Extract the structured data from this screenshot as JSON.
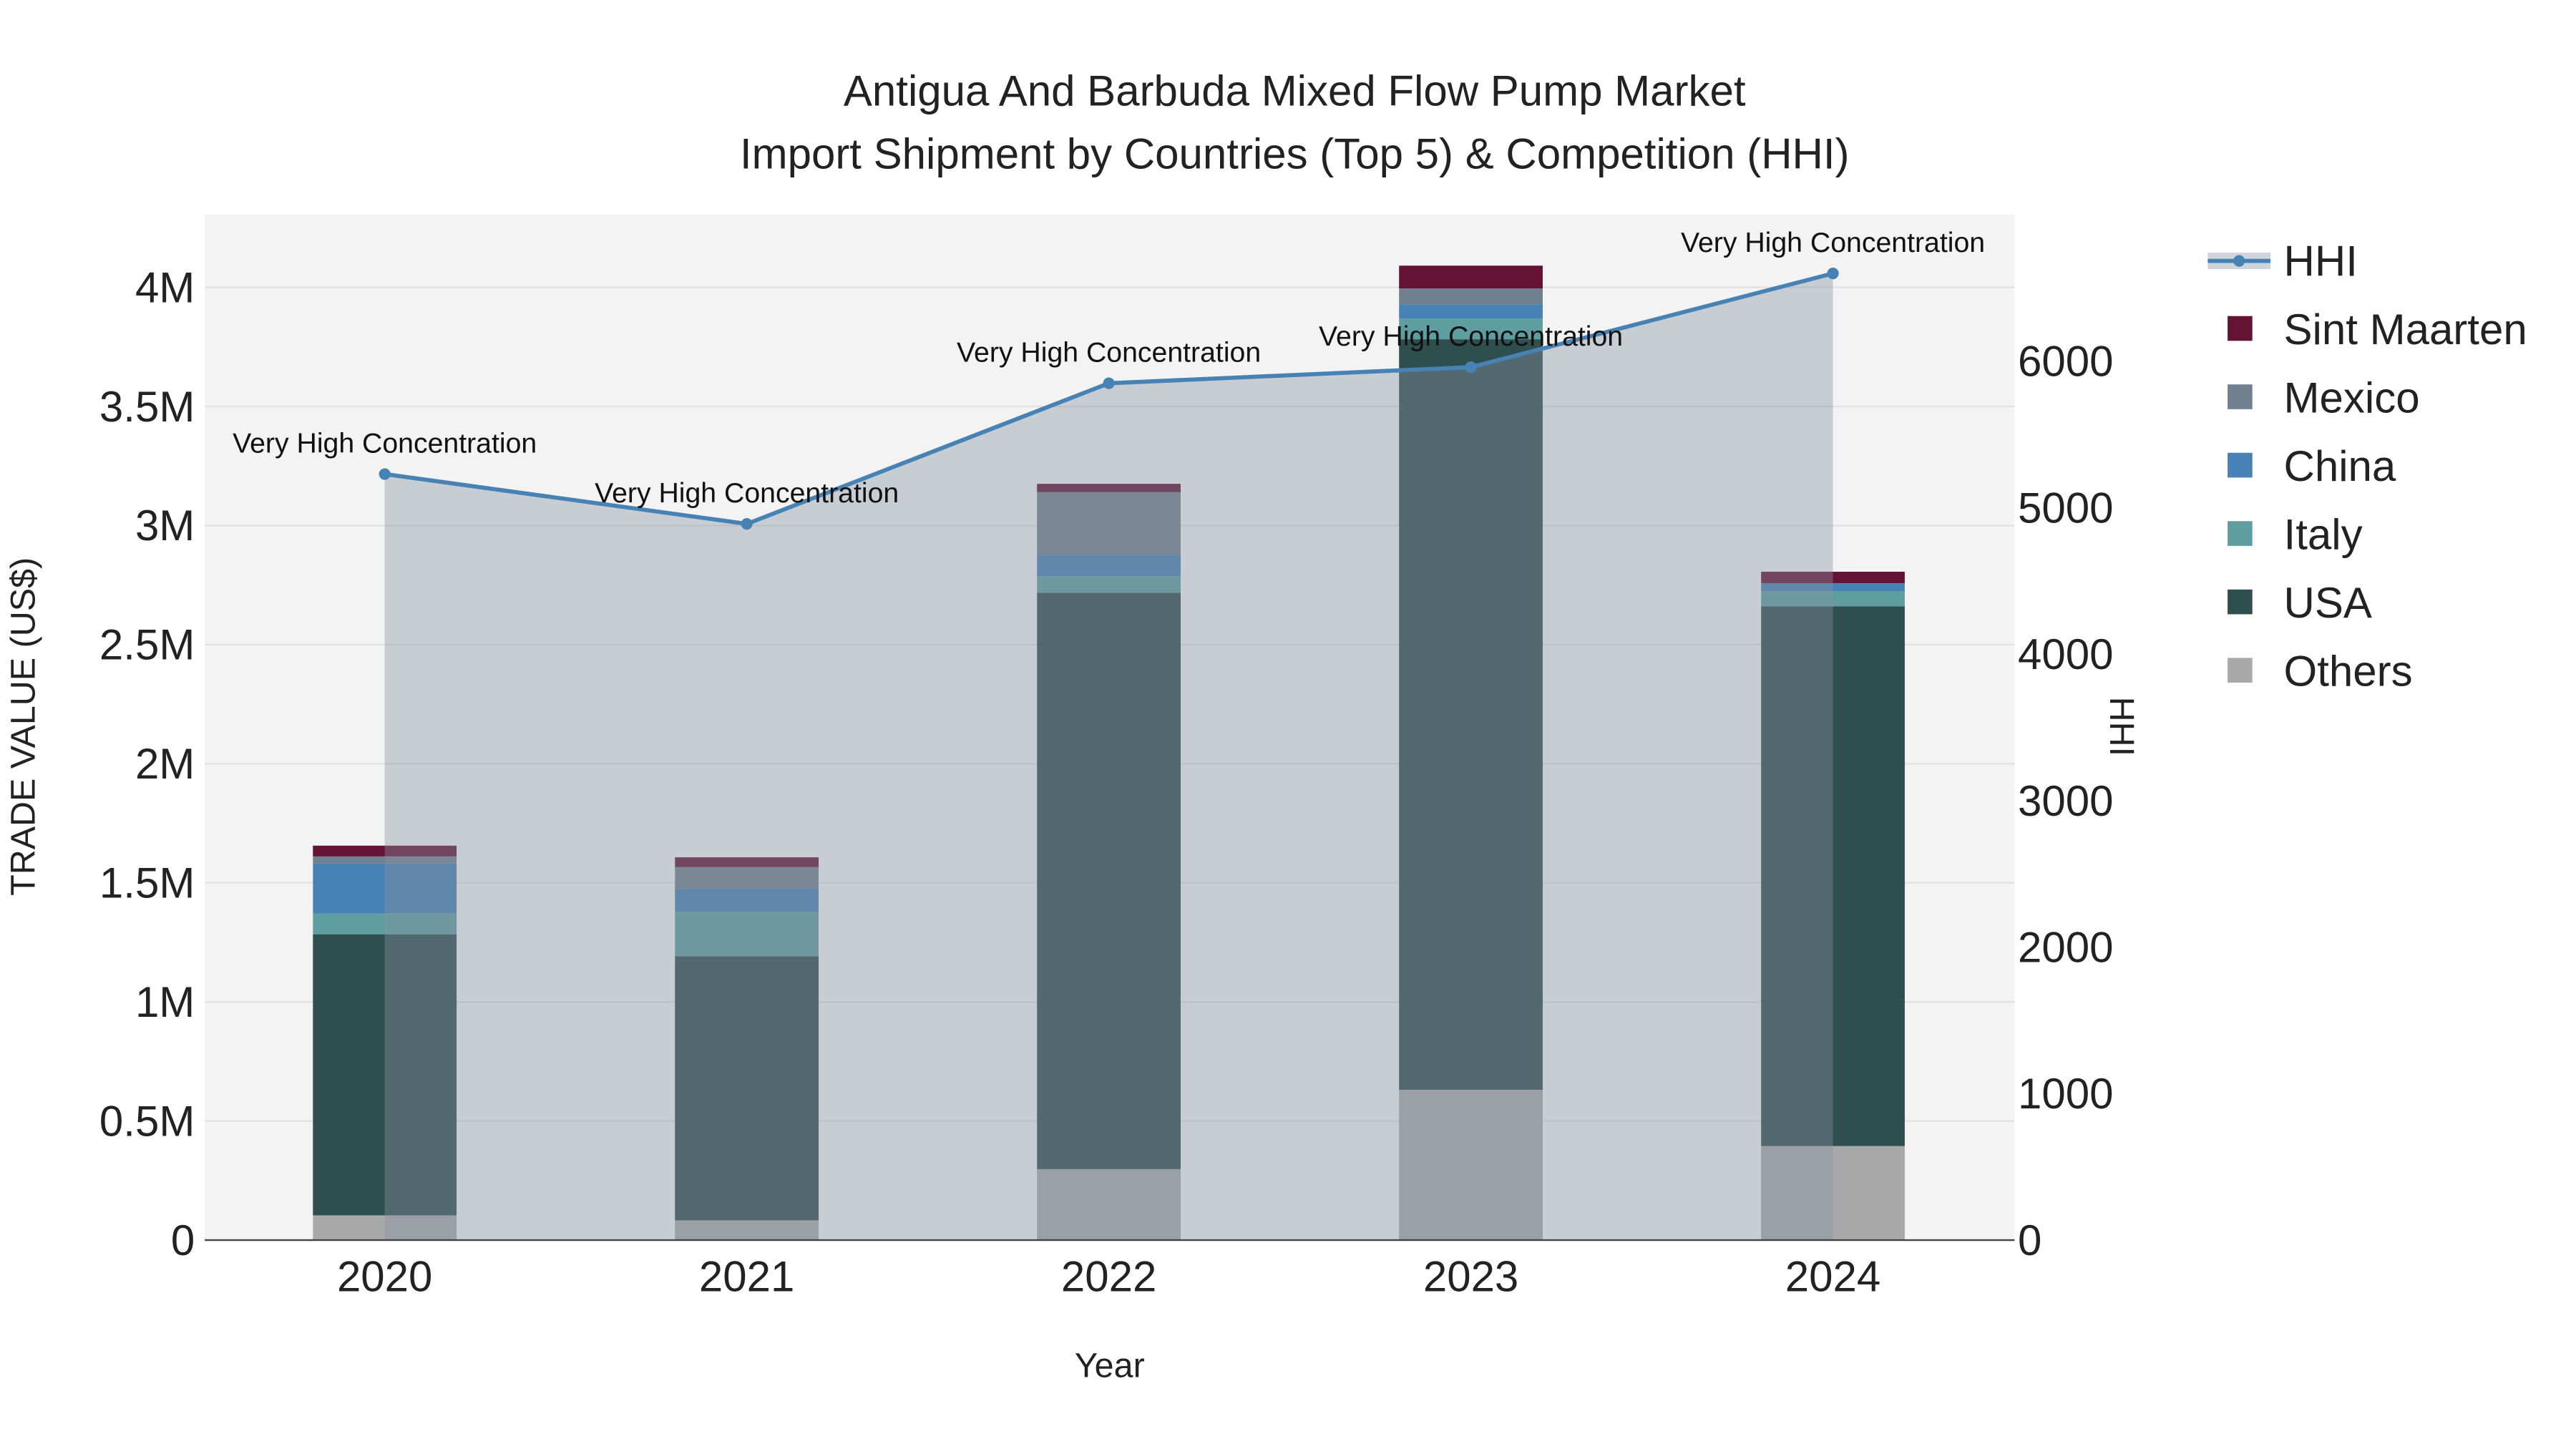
{
  "chart_data": {
    "type": "bar",
    "title_line1": "Antigua And Barbuda Mixed Flow Pump Market",
    "title_line2": "Import Shipment by Countries (Top 5) & Competition (HHI)",
    "xlabel": "Year",
    "ylabel": "TRADE VALUE (US$)",
    "y2label": "HHI",
    "categories": [
      "2020",
      "2021",
      "2022",
      "2023",
      "2024"
    ],
    "ylim": [
      0,
      4300000
    ],
    "y2lim": [
      0,
      7000
    ],
    "yticks": [
      {
        "v": 0,
        "label": "0"
      },
      {
        "v": 500000,
        "label": "0.5M"
      },
      {
        "v": 1000000,
        "label": "1M"
      },
      {
        "v": 1500000,
        "label": "1.5M"
      },
      {
        "v": 2000000,
        "label": "2M"
      },
      {
        "v": 2500000,
        "label": "2.5M"
      },
      {
        "v": 3000000,
        "label": "3M"
      },
      {
        "v": 3500000,
        "label": "3.5M"
      },
      {
        "v": 4000000,
        "label": "4M"
      }
    ],
    "y2ticks": [
      {
        "v": 0,
        "label": "0"
      },
      {
        "v": 1000,
        "label": "1000"
      },
      {
        "v": 2000,
        "label": "2000"
      },
      {
        "v": 3000,
        "label": "3000"
      },
      {
        "v": 4000,
        "label": "4000"
      },
      {
        "v": 5000,
        "label": "5000"
      },
      {
        "v": 6000,
        "label": "6000"
      }
    ],
    "series": [
      {
        "name": "Others",
        "color": "#a9a9a9",
        "values": [
          104000,
          83000,
          298000,
          631000,
          395000
        ]
      },
      {
        "name": "USA",
        "color": "#2f4f4f",
        "values": [
          1180000,
          1109000,
          2420000,
          3151000,
          2266000
        ]
      },
      {
        "name": "Italy",
        "color": "#5f9ea0",
        "values": [
          87000,
          187000,
          69000,
          87000,
          64000
        ]
      },
      {
        "name": "China",
        "color": "#4682b4",
        "values": [
          210000,
          97000,
          90000,
          60000,
          30000
        ]
      },
      {
        "name": "Mexico",
        "color": "#708090",
        "values": [
          30000,
          90000,
          263000,
          66000,
          3000
        ]
      },
      {
        "name": "Sint Maarten",
        "color": "#641335",
        "values": [
          45000,
          41000,
          35000,
          96000,
          48000
        ]
      }
    ],
    "hhi": {
      "name": "HHI",
      "color": "#4682b4",
      "values": [
        5230,
        4890,
        5850,
        5960,
        6600
      ],
      "annotations": [
        "Very High Concentration",
        "Very High Concentration",
        "Very High Concentration",
        "Very High Concentration",
        "Very High Concentration"
      ]
    },
    "legend": [
      "HHI",
      "Sint Maarten",
      "Mexico",
      "China",
      "Italy",
      "USA",
      "Others"
    ],
    "legend_position": "right",
    "grid": true
  }
}
